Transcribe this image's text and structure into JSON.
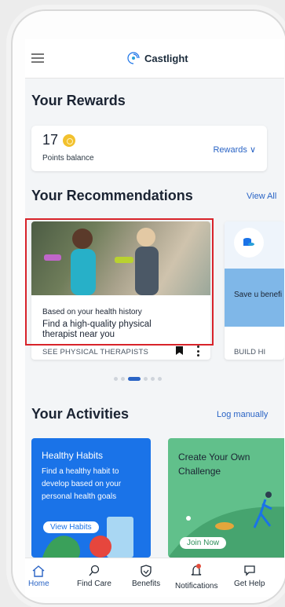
{
  "header": {
    "app_name": "Castlight"
  },
  "rewards": {
    "title": "Your Rewards",
    "points": "17",
    "points_label": "Points balance",
    "link": "Rewards"
  },
  "recommendations": {
    "title": "Your Recommendations",
    "view_all": "View All",
    "card1": {
      "meta": "Based on your health history",
      "title": "Find a high-quality physical therapist near you",
      "cta": "SEE PHYSICAL THERAPISTS"
    },
    "card2": {
      "text": "Save u benefi",
      "cta": "BUILD HI"
    },
    "carousel": {
      "count": 6,
      "active_index": 2
    }
  },
  "activities": {
    "title": "Your Activities",
    "log_link": "Log manually",
    "card1": {
      "title": "Healthy Habits",
      "description": "Find a healthy habit to develop based on your personal health goals",
      "button": "View Habits"
    },
    "card2": {
      "title": "Create Your Own Challenge",
      "button": "Join Now"
    }
  },
  "nav": {
    "items": [
      {
        "label": "Home",
        "icon": "home-icon",
        "active": true
      },
      {
        "label": "Find Care",
        "icon": "search-icon",
        "active": false
      },
      {
        "label": "Benefits",
        "icon": "shield-icon",
        "active": false
      },
      {
        "label": "Notifications",
        "icon": "bell-icon",
        "active": false
      },
      {
        "label": "Get Help",
        "icon": "chat-icon",
        "active": false
      }
    ]
  },
  "colors": {
    "accent": "#2a64c5",
    "highlight": "#d8232a",
    "activity_blue": "#1a73e8",
    "activity_green": "#61c08b",
    "coin": "#f2c12e"
  }
}
